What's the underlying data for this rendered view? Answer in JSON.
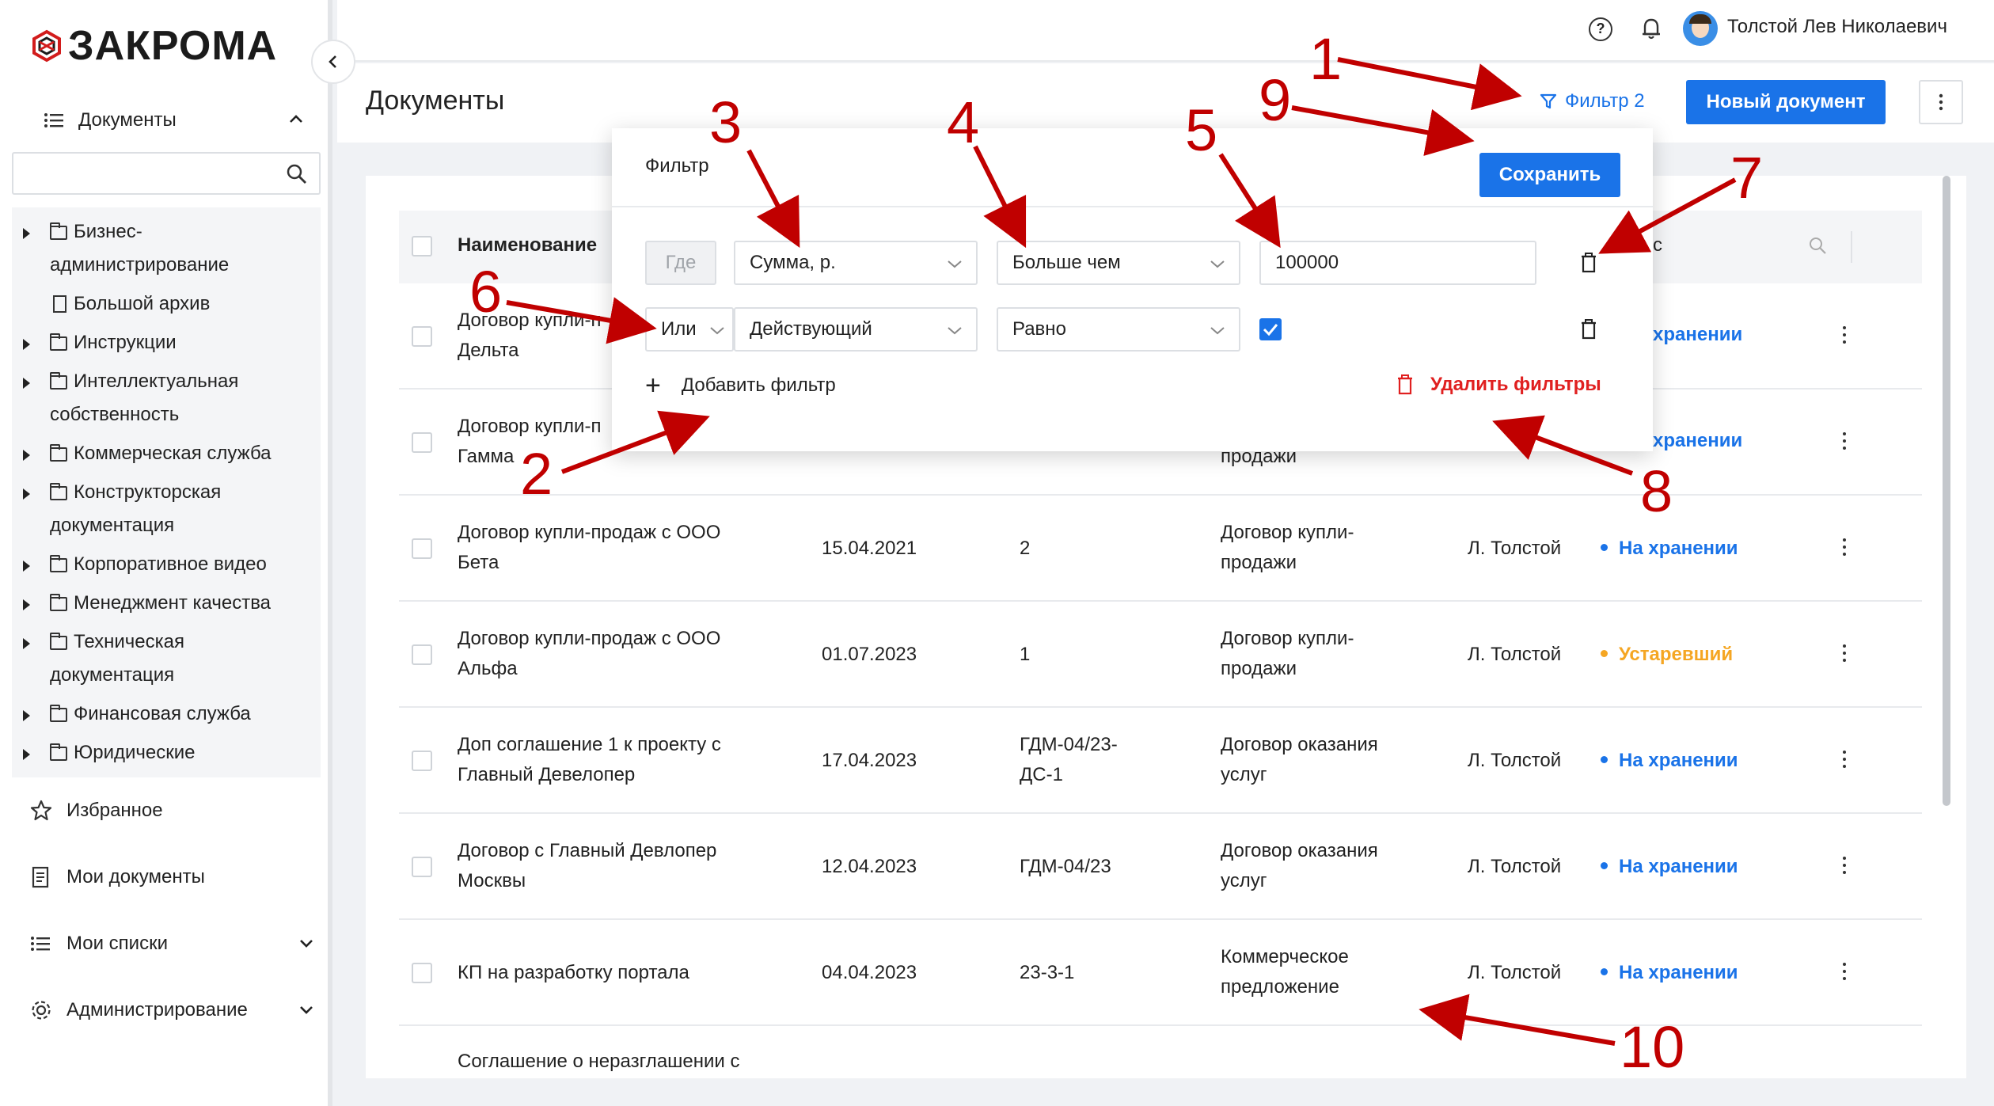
{
  "app": {
    "logo_text": "ЗАКРОМА"
  },
  "sidebar": {
    "documents_label": "Документы",
    "search_placeholder": "",
    "tree": [
      {
        "line1": "Бизнес-",
        "line2": "администрирование",
        "type": "folder",
        "expandable": true
      },
      {
        "line1": "Большой архив",
        "line2": "",
        "type": "file",
        "expandable": false
      },
      {
        "line1": "Инструкции",
        "line2": "",
        "type": "folder",
        "expandable": true
      },
      {
        "line1": "Интеллектуальная",
        "line2": "собственность",
        "type": "folder",
        "expandable": true
      },
      {
        "line1": "Коммерческая служба",
        "line2": "",
        "type": "folder",
        "expandable": true
      },
      {
        "line1": "Конструкторская",
        "line2": "документация",
        "type": "folder",
        "expandable": true
      },
      {
        "line1": "Корпоративное видео",
        "line2": "",
        "type": "folder",
        "expandable": true
      },
      {
        "line1": "Менеджмент качества",
        "line2": "",
        "type": "folder",
        "expandable": true
      },
      {
        "line1": "Техническая",
        "line2": "документация",
        "type": "folder",
        "expandable": true
      },
      {
        "line1": "Финансовая служба",
        "line2": "",
        "type": "folder",
        "expandable": true
      },
      {
        "line1": "Юридические",
        "line2": "",
        "type": "folder",
        "expandable": true
      }
    ],
    "favorites_label": "Избранное",
    "my_docs_label": "Мои документы",
    "my_lists_label": "Мои списки",
    "admin_label": "Администрирование"
  },
  "header": {
    "user_name": "Толстой Лев Николаевич",
    "page_title": "Документы",
    "filter_label": "Фильтр 2",
    "new_doc_label": "Новый документ"
  },
  "table": {
    "col_name": "Наименование",
    "col_status_partial": "с",
    "rows": [
      {
        "name1": "Договор купли-п",
        "name2": "Дельта",
        "date": "",
        "num1": "",
        "num2": "",
        "type1": "",
        "type2": "",
        "author": "",
        "status": "хранении",
        "status_color": "#1a73e8"
      },
      {
        "name1": "Договор купли-п",
        "name2": "Гамма",
        "date": "",
        "num1": "",
        "num2": "",
        "type1": "",
        "type2": "продажи",
        "author": "",
        "status": "хранении",
        "status_color": "#1a73e8"
      },
      {
        "name1": "Договор купли-продаж с ООО",
        "name2": "Бета",
        "date": "15.04.2021",
        "num1": "2",
        "num2": "",
        "type1": "Договор купли-",
        "type2": "продажи",
        "author": "Л. Толстой",
        "status": "На хранении",
        "status_color": "#1a73e8"
      },
      {
        "name1": "Договор купли-продаж с ООО",
        "name2": "Альфа",
        "date": "01.07.2023",
        "num1": "1",
        "num2": "",
        "type1": "Договор купли-",
        "type2": "продажи",
        "author": "Л. Толстой",
        "status": "Устаревший",
        "status_color": "#f5a623"
      },
      {
        "name1": "Доп соглашение 1 к проекту с",
        "name2": "Главный Девелопер",
        "date": "17.04.2023",
        "num1": "ГДМ-04/23-",
        "num2": "ДС-1",
        "type1": "Договор оказания",
        "type2": "услуг",
        "author": "Л. Толстой",
        "status": "На хранении",
        "status_color": "#1a73e8"
      },
      {
        "name1": "Договор с Главный Девлопер",
        "name2": "Москвы",
        "date": "12.04.2023",
        "num1": "ГДМ-04/23",
        "num2": "",
        "type1": "Договор оказания",
        "type2": "услуг",
        "author": "Л. Толстой",
        "status": "На хранении",
        "status_color": "#1a73e8"
      },
      {
        "name1": "КП на разработку портала",
        "name2": "",
        "date": "04.04.2023",
        "num1": "23-3-1",
        "num2": "",
        "type1": "Коммерческое",
        "type2": "предложение",
        "author": "Л. Толстой",
        "status": "На хранении",
        "status_color": "#1a73e8"
      },
      {
        "name1": "Соглашение о неразглашении с",
        "name2": "",
        "date": "",
        "num1": "",
        "num2": "",
        "type1": "",
        "type2": "",
        "author": "",
        "status": "",
        "status_color": "#1a73e8"
      }
    ]
  },
  "filter": {
    "title": "Фильтр",
    "save_label": "Сохранить",
    "row1": {
      "prefix": "Где",
      "field": "Сумма, р.",
      "operator": "Больше чем",
      "value": "100000"
    },
    "row2": {
      "prefix": "Или",
      "field": "Действующий",
      "operator": "Равно",
      "checked": true
    },
    "add_label": "Добавить фильтр",
    "delete_all_label": "Удалить фильтры"
  },
  "annotations": [
    "1",
    "2",
    "3",
    "4",
    "5",
    "6",
    "7",
    "8",
    "9",
    "10"
  ],
  "colors": {
    "accent": "#1a73e8",
    "danger": "#e02020",
    "warning": "#f5a623",
    "annotation": "#c00000"
  }
}
